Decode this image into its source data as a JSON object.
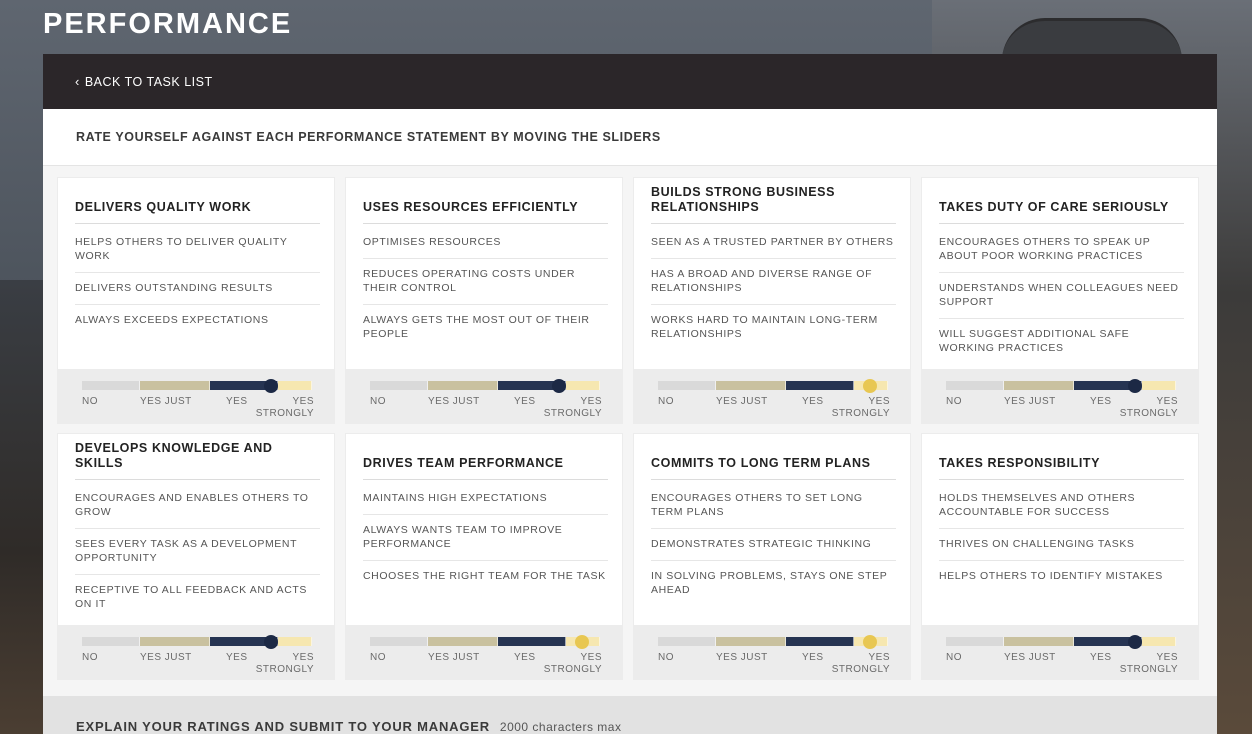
{
  "page": {
    "title": "PERFORMANCE"
  },
  "nav": {
    "back_label": "BACK TO TASK LIST"
  },
  "instructions": "RATE YOURSELF AGAINST EACH PERFORMANCE STATEMENT BY MOVING THE SLIDERS",
  "scale_labels": {
    "no": "NO",
    "yes_just": "YES JUST",
    "yes": "YES",
    "yes_strongly_line1": "YES",
    "yes_strongly_line2": "STRONGLY"
  },
  "colors": {
    "track_no": "#d9d9d9",
    "track_just": "#c9c19f",
    "track_yes": "#263452",
    "track_strong": "#f6e7b0",
    "thumb_navy": "#1c2945",
    "thumb_gold": "#e8c752"
  },
  "cards": [
    {
      "title": "DELIVERS QUALITY WORK",
      "statements": [
        "HELPS OTHERS TO DELIVER QUALITY WORK",
        "DELIVERS OUTSTANDING RESULTS",
        "ALWAYS EXCEEDS EXPECTATIONS"
      ],
      "rating": 0.82,
      "thumb": "navy"
    },
    {
      "title": "USES RESOURCES EFFICIENTLY",
      "statements": [
        "OPTIMISES RESOURCES",
        "REDUCES OPERATING COSTS UNDER THEIR CONTROL",
        "ALWAYS GETS THE MOST OUT OF THEIR PEOPLE"
      ],
      "rating": 0.82,
      "thumb": "navy"
    },
    {
      "title": "BUILDS STRONG BUSINESS RELATIONSHIPS",
      "statements": [
        "SEEN AS A TRUSTED PARTNER BY OTHERS",
        "HAS A BROAD AND DIVERSE RANGE OF RELATIONSHIPS",
        "WORKS HARD TO MAINTAIN LONG-TERM RELATIONSHIPS"
      ],
      "rating": 0.92,
      "thumb": "gold"
    },
    {
      "title": "TAKES DUTY OF CARE SERIOUSLY",
      "statements": [
        "ENCOURAGES OTHERS TO SPEAK UP ABOUT POOR WORKING PRACTICES",
        "UNDERSTANDS WHEN COLLEAGUES NEED SUPPORT",
        "WILL SUGGEST ADDITIONAL SAFE WORKING PRACTICES"
      ],
      "rating": 0.82,
      "thumb": "navy"
    },
    {
      "title": "DEVELOPS KNOWLEDGE AND SKILLS",
      "statements": [
        "ENCOURAGES AND ENABLES OTHERS TO GROW",
        "SEES EVERY TASK AS A DEVELOPMENT OPPORTUNITY",
        "RECEPTIVE TO ALL FEEDBACK AND ACTS ON IT"
      ],
      "rating": 0.82,
      "thumb": "navy"
    },
    {
      "title": "DRIVES TEAM PERFORMANCE",
      "statements": [
        "MAINTAINS HIGH EXPECTATIONS",
        "ALWAYS WANTS TEAM TO IMPROVE PERFORMANCE",
        "CHOOSES THE RIGHT TEAM FOR THE TASK"
      ],
      "rating": 0.92,
      "thumb": "gold"
    },
    {
      "title": "COMMITS TO LONG TERM PLANS",
      "statements": [
        "ENCOURAGES OTHERS TO SET LONG TERM PLANS",
        "DEMONSTRATES STRATEGIC THINKING",
        "IN SOLVING PROBLEMS, STAYS ONE STEP AHEAD"
      ],
      "rating": 0.92,
      "thumb": "gold"
    },
    {
      "title": "TAKES RESPONSIBILITY",
      "statements": [
        "HOLDS THEMSELVES AND OTHERS ACCOUNTABLE FOR SUCCESS",
        "THRIVES ON CHALLENGING TASKS",
        "HELPS OTHERS TO IDENTIFY MISTAKES"
      ],
      "rating": 0.82,
      "thumb": "navy"
    }
  ],
  "footer": {
    "title": "EXPLAIN YOUR RATINGS AND SUBMIT TO YOUR MANAGER",
    "hint": "2000 characters max"
  }
}
